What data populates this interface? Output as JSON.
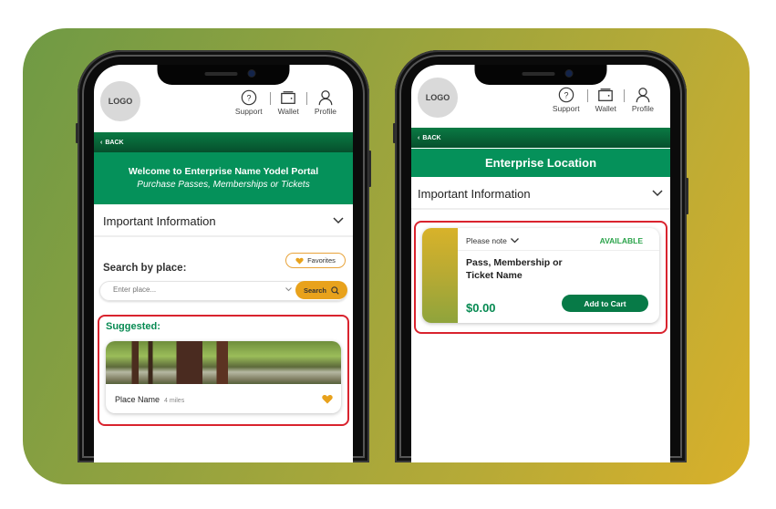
{
  "colors": {
    "primary_green": "#05915a",
    "dark_green": "#064f2c",
    "accent_orange": "#e8a21c",
    "highlight_red": "#d9232e",
    "available_green": "#2aa34a",
    "panel_gradient_start": "#6f9a45",
    "panel_gradient_end": "#d9b02a"
  },
  "header": {
    "logo_text": "LOGO",
    "nav": [
      {
        "icon": "question-circle-icon",
        "label": "Support"
      },
      {
        "icon": "wallet-icon",
        "label": "Wallet"
      },
      {
        "icon": "user-icon",
        "label": "Profile"
      }
    ]
  },
  "left_screen": {
    "back_label": "BACK",
    "welcome_title": "Welcome to Enterprise Name Yodel Portal",
    "welcome_subtitle": "Purchase Passes, Memberships or Tickets",
    "info_label": "Important Information",
    "favorites_label": "Favorites",
    "search_label": "Search by place:",
    "search_placeholder": "Enter place...",
    "search_button": "Search",
    "suggested_label": "Suggested:",
    "place": {
      "name": "Place Name",
      "distance": "4 miles",
      "favorited": true
    }
  },
  "right_screen": {
    "back_label": "BACK",
    "location_title": "Enterprise Location",
    "info_label": "Important Information",
    "pass": {
      "note_label": "Please note",
      "status": "AVAILABLE",
      "name": "Pass, Membership or Ticket Name",
      "price": "$0.00",
      "add_button": "Add to Cart"
    }
  }
}
